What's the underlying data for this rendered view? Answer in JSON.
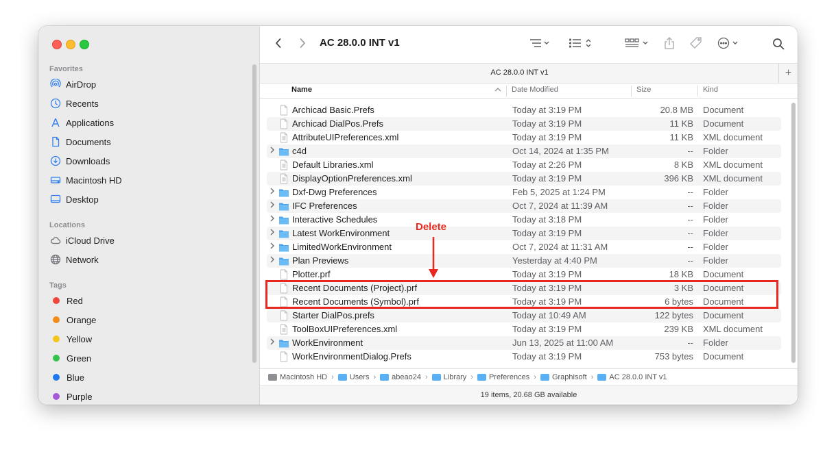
{
  "window": {
    "title": "AC 28.0.0 INT v1",
    "tab_title": "AC 28.0.0 INT v1",
    "tab_plus": "+"
  },
  "sidebar": {
    "favorites_label": "Favorites",
    "favorites": [
      {
        "label": "AirDrop",
        "icon": "airdrop-icon"
      },
      {
        "label": "Recents",
        "icon": "clock-icon"
      },
      {
        "label": "Applications",
        "icon": "applications-icon"
      },
      {
        "label": "Documents",
        "icon": "document-icon"
      },
      {
        "label": "Downloads",
        "icon": "download-icon"
      },
      {
        "label": "Macintosh HD",
        "icon": "hard-drive-icon"
      },
      {
        "label": "Desktop",
        "icon": "desktop-icon"
      }
    ],
    "locations_label": "Locations",
    "locations": [
      {
        "label": "iCloud Drive",
        "icon": "cloud-icon"
      },
      {
        "label": "Network",
        "icon": "globe-icon"
      }
    ],
    "tags_label": "Tags",
    "tags": [
      {
        "label": "Red",
        "color": "#f0463c"
      },
      {
        "label": "Orange",
        "color": "#f28c1c"
      },
      {
        "label": "Yellow",
        "color": "#f6c51b"
      },
      {
        "label": "Green",
        "color": "#34c24a"
      },
      {
        "label": "Blue",
        "color": "#1e78f0"
      },
      {
        "label": "Purple",
        "color": "#a45ad8"
      }
    ]
  },
  "columns": {
    "name": "Name",
    "date": "Date Modified",
    "size": "Size",
    "kind": "Kind"
  },
  "files": [
    {
      "name": "Archicad Basic.Prefs",
      "date": "Today at 3:19 PM",
      "size": "20.8 MB",
      "kind": "Document",
      "type": "doc"
    },
    {
      "name": "Archicad DialPos.Prefs",
      "date": "Today at 3:19 PM",
      "size": "11 KB",
      "kind": "Document",
      "type": "doc"
    },
    {
      "name": "AttributeUIPreferences.xml",
      "date": "Today at 3:19 PM",
      "size": "11 KB",
      "kind": "XML document",
      "type": "xml"
    },
    {
      "name": "c4d",
      "date": "Oct 14, 2024 at 1:35 PM",
      "size": "--",
      "kind": "Folder",
      "type": "folder"
    },
    {
      "name": "Default Libraries.xml",
      "date": "Today at 2:26 PM",
      "size": "8 KB",
      "kind": "XML document",
      "type": "xml"
    },
    {
      "name": "DisplayOptionPreferences.xml",
      "date": "Today at 3:19 PM",
      "size": "396 KB",
      "kind": "XML document",
      "type": "xml"
    },
    {
      "name": "Dxf-Dwg Preferences",
      "date": "Feb 5, 2025 at 1:24 PM",
      "size": "--",
      "kind": "Folder",
      "type": "folder"
    },
    {
      "name": "IFC Preferences",
      "date": "Oct 7, 2024 at 11:39 AM",
      "size": "--",
      "kind": "Folder",
      "type": "folder"
    },
    {
      "name": "Interactive Schedules",
      "date": "Today at 3:18 PM",
      "size": "--",
      "kind": "Folder",
      "type": "folder"
    },
    {
      "name": "Latest WorkEnvironment",
      "date": "Today at 3:19 PM",
      "size": "--",
      "kind": "Folder",
      "type": "folder"
    },
    {
      "name": "LimitedWorkEnvironment",
      "date": "Oct 7, 2024 at 11:31 AM",
      "size": "--",
      "kind": "Folder",
      "type": "folder"
    },
    {
      "name": "Plan Previews",
      "date": "Yesterday at 4:40 PM",
      "size": "--",
      "kind": "Folder",
      "type": "folder"
    },
    {
      "name": "Plotter.prf",
      "date": "Today at 3:19 PM",
      "size": "18 KB",
      "kind": "Document",
      "type": "doc"
    },
    {
      "name": "Recent Documents (Project).prf",
      "date": "Today at 3:19 PM",
      "size": "3 KB",
      "kind": "Document",
      "type": "doc"
    },
    {
      "name": "Recent Documents (Symbol).prf",
      "date": "Today at 3:19 PM",
      "size": "6 bytes",
      "kind": "Document",
      "type": "doc"
    },
    {
      "name": "Starter DialPos.prefs",
      "date": "Today at 10:49 AM",
      "size": "122 bytes",
      "kind": "Document",
      "type": "doc"
    },
    {
      "name": "ToolBoxUIPreferences.xml",
      "date": "Today at 3:19 PM",
      "size": "239 KB",
      "kind": "XML document",
      "type": "xml"
    },
    {
      "name": "WorkEnvironment",
      "date": "Jun 13, 2025 at 11:00 AM",
      "size": "--",
      "kind": "Folder",
      "type": "folder"
    },
    {
      "name": "WorkEnvironmentDialog.Prefs",
      "date": "Today at 3:19 PM",
      "size": "753 bytes",
      "kind": "Document",
      "type": "doc"
    }
  ],
  "path": [
    {
      "label": "Macintosh HD",
      "color": "#8e8e93"
    },
    {
      "label": "Users",
      "color": "#5ab0f5"
    },
    {
      "label": "abeao24",
      "color": "#5ab0f5"
    },
    {
      "label": "Library",
      "color": "#5ab0f5"
    },
    {
      "label": "Preferences",
      "color": "#5ab0f5"
    },
    {
      "label": "Graphisoft",
      "color": "#5ab0f5"
    },
    {
      "label": "AC 28.0.0 INT v1",
      "color": "#5ab0f5"
    }
  ],
  "status": "19 items, 20.68 GB available",
  "annotation": {
    "label": "Delete",
    "color": "#e8281f"
  }
}
